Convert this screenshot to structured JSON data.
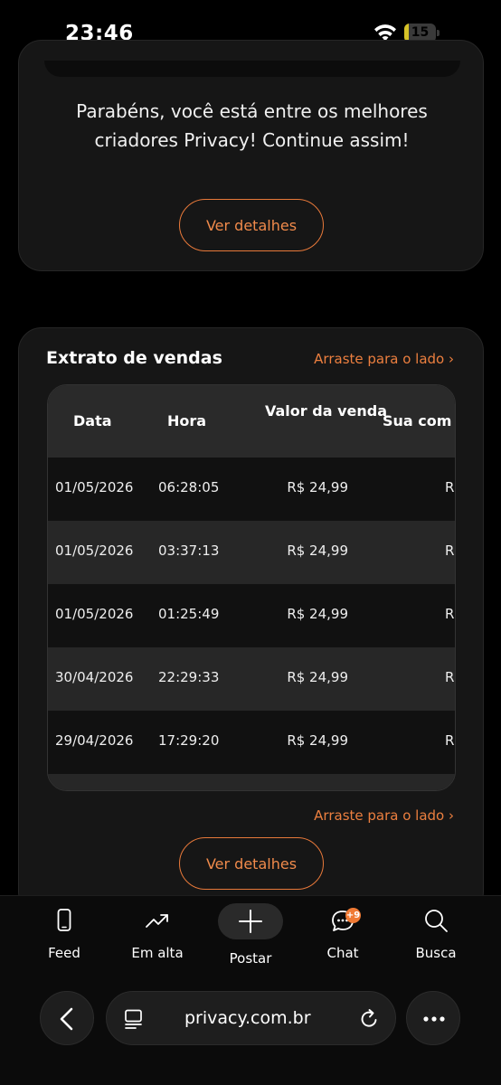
{
  "status_bar": {
    "time": "23:46",
    "battery_level": "15",
    "battery_fraction": 0.15
  },
  "highlight_card": {
    "message": "Parabéns, você está entre os melhores criadores Privacy! Continue assim!",
    "details_button": "Ver detalhes"
  },
  "sales_card": {
    "title": "Extrato de vendas",
    "swipe_hint": "Arraste para o lado ›",
    "columns": {
      "date": "Data",
      "time": "Hora",
      "value": "Valor da venda",
      "commission": "Sua com"
    },
    "rows": [
      {
        "date": "01/05/2026",
        "time": "06:28:05",
        "value": "R$ 24,99",
        "commission": "R"
      },
      {
        "date": "01/05/2026",
        "time": "03:37:13",
        "value": "R$ 24,99",
        "commission": "R"
      },
      {
        "date": "01/05/2026",
        "time": "01:25:49",
        "value": "R$ 24,99",
        "commission": "R"
      },
      {
        "date": "30/04/2026",
        "time": "22:29:33",
        "value": "R$ 24,99",
        "commission": "R"
      },
      {
        "date": "29/04/2026",
        "time": "17:29:20",
        "value": "R$ 24,99",
        "commission": "R"
      }
    ],
    "details_button": "Ver detalhes"
  },
  "bottom_nav": {
    "items": [
      {
        "label": "Feed",
        "icon": "phone-icon"
      },
      {
        "label": "Em alta",
        "icon": "trending-icon"
      },
      {
        "label": "Postar",
        "icon": "plus-icon"
      },
      {
        "label": "Chat",
        "icon": "chat-icon",
        "badge": "+9"
      },
      {
        "label": "Busca",
        "icon": "search-icon"
      }
    ]
  },
  "browser": {
    "url": "privacy.com.br"
  },
  "colors": {
    "accent": "#ec7f3f",
    "background": "#000000",
    "card": "#161616"
  }
}
